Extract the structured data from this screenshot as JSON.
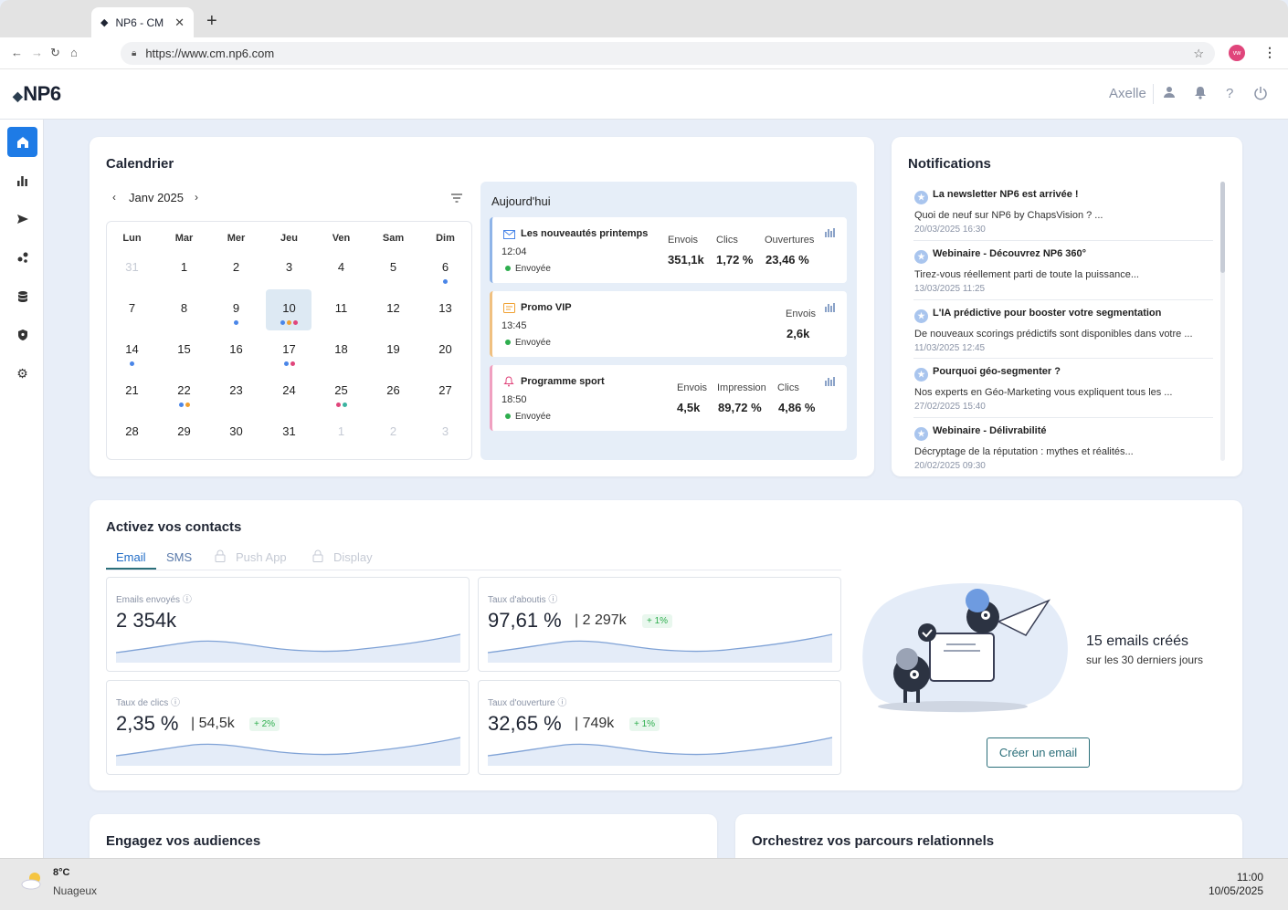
{
  "browser": {
    "tab_title": "NP6 - CM",
    "url": "https://www.cm.np6.com",
    "avatar_initials": "vw"
  },
  "header": {
    "logo": "NP6",
    "user_name": "Axelle"
  },
  "calendar": {
    "title": "Calendrier",
    "month": "Janv 2025",
    "weekdays": [
      "Lun",
      "Mar",
      "Mer",
      "Jeu",
      "Ven",
      "Sam",
      "Dim"
    ],
    "weeks": [
      [
        "31",
        "1",
        "2",
        "3",
        "4",
        "5",
        "6"
      ],
      [
        "7",
        "8",
        "9",
        "10",
        "11",
        "12",
        "13"
      ],
      [
        "14",
        "15",
        "16",
        "17",
        "18",
        "19",
        "20"
      ],
      [
        "21",
        "22",
        "23",
        "24",
        "25",
        "26",
        "27"
      ],
      [
        "28",
        "29",
        "30",
        "31",
        "1",
        "2",
        "3"
      ]
    ]
  },
  "today": {
    "title": "Aujourd'hui",
    "events": [
      {
        "title": "Les nouveautés printemps",
        "time": "12:04",
        "status": "Envoyée",
        "kpis": [
          {
            "label": "Envois",
            "value": "351,1k"
          },
          {
            "label": "Clics",
            "value": "1,72 %"
          },
          {
            "label": "Ouvertures",
            "value": "23,46 %"
          }
        ]
      },
      {
        "title": "Promo VIP",
        "time": "13:45",
        "status": "Envoyée",
        "kpis": [
          {
            "label": "Envois",
            "value": "2,6k"
          }
        ]
      },
      {
        "title": "Programme sport",
        "time": "18:50",
        "status": "Envoyée",
        "kpis": [
          {
            "label": "Envois",
            "value": "4,5k"
          },
          {
            "label": "Impression",
            "value": "89,72 %"
          },
          {
            "label": "Clics",
            "value": "4,86 %"
          }
        ]
      }
    ]
  },
  "notifications": {
    "title": "Notifications",
    "items": [
      {
        "title": "La newsletter NP6 est arrivée !",
        "desc": "Quoi de neuf sur NP6 by ChapsVision ? ...",
        "date": "20/03/2025 16:30"
      },
      {
        "title": "Webinaire - Découvrez NP6 360°",
        "desc": "Tirez-vous réellement parti de toute la puissance...",
        "date": "13/03/2025 11:25"
      },
      {
        "title": "L'IA prédictive pour booster votre segmentation",
        "desc": "De nouveaux scorings prédictifs sont disponibles dans votre ...",
        "date": "11/03/2025 12:45"
      },
      {
        "title": "Pourquoi géo-segmenter ?",
        "desc": "Nos experts en Géo-Marketing vous expliquent tous les ...",
        "date": "27/02/2025 15:40"
      },
      {
        "title": "Webinaire - Délivrabilité",
        "desc": "Décryptage de la réputation : mythes et réalités...",
        "date": "20/02/2025 09:30"
      }
    ]
  },
  "activate": {
    "title": "Activez vos contacts",
    "tabs": [
      "Email",
      "SMS",
      "Push App",
      "Display"
    ],
    "metrics": [
      {
        "label": "Emails envoyés",
        "value": "2 354k",
        "sub": "",
        "delta": ""
      },
      {
        "label": "Taux d'aboutis",
        "value": "97,61 %",
        "sub": "| 2 297k",
        "delta": "+ 1%"
      },
      {
        "label": "Taux de clics",
        "value": "2,35 %",
        "sub": "| 54,5k",
        "delta": "+ 2%"
      },
      {
        "label": "Taux d'ouverture",
        "value": "32,65 %",
        "sub": "| 749k",
        "delta": "+ 1%"
      }
    ],
    "promo_title": "15 emails créés",
    "promo_sub": "sur les 30 derniers jours",
    "create_button": "Créer un email"
  },
  "bottom": {
    "left_title": "Engagez vos audiences",
    "right_title": "Orchestrez vos parcours relationnels"
  },
  "taskbar": {
    "temp": "8°C",
    "weather": "Nuageux",
    "time": "11:00",
    "date": "10/05/2025"
  },
  "colors": {
    "accent": "#1e7be6",
    "teal": "#2b6f7a",
    "green": "#2eae4e"
  }
}
